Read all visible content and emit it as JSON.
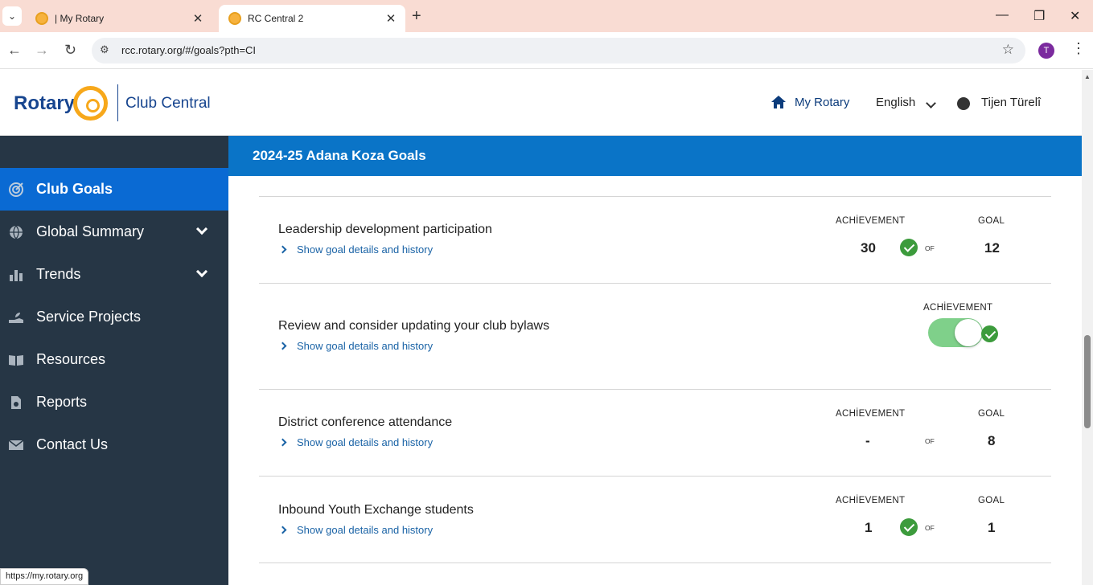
{
  "browser": {
    "tabs": [
      {
        "label": "| My Rotary"
      },
      {
        "label": "RC Central 2"
      }
    ],
    "url": "rcc.rotary.org/#/goals?pth=CI",
    "profile_initial": "T",
    "status_url": "https://my.rotary.org"
  },
  "header": {
    "logo_text": "Rotary",
    "app_name": "Club Central",
    "my_rotary": "My Rotary",
    "language": "English",
    "user_name": "Tijen Türelî"
  },
  "sidebar": {
    "items": [
      {
        "label": "Club Goals",
        "icon": "target-icon",
        "active": true
      },
      {
        "label": "Global Summary",
        "icon": "globe-icon"
      },
      {
        "label": "Trends",
        "icon": "bar-chart-icon"
      },
      {
        "label": "Service Projects",
        "icon": "hand-plant-icon"
      },
      {
        "label": "Resources",
        "icon": "book-icon"
      },
      {
        "label": "Reports",
        "icon": "report-icon"
      },
      {
        "label": "Contact Us",
        "icon": "envelope-icon"
      }
    ]
  },
  "banner": {
    "title": "2024-25 Adana Koza Goals"
  },
  "labels": {
    "achievement": "ACHİEVEMENT",
    "goal": "GOAL",
    "of": "OF",
    "details": "Show goal details and history"
  },
  "goals": [
    {
      "title": "Leadership development participation",
      "achievement": "30",
      "goal": "12",
      "achieved": true
    },
    {
      "title": "Review and consider updating your club bylaws",
      "toggle_on": true,
      "achieved": true
    },
    {
      "title": "District conference attendance",
      "achievement": "-",
      "goal": "8",
      "achieved": false
    },
    {
      "title": "Inbound Youth Exchange students",
      "achievement": "1",
      "goal": "1",
      "achieved": true
    }
  ],
  "colors": {
    "sidebar_bg": "#263645",
    "active_item": "#0a6ad3",
    "banner": "#0a74c7",
    "check": "#3c9b3c",
    "toggle": "#7fd08a"
  }
}
